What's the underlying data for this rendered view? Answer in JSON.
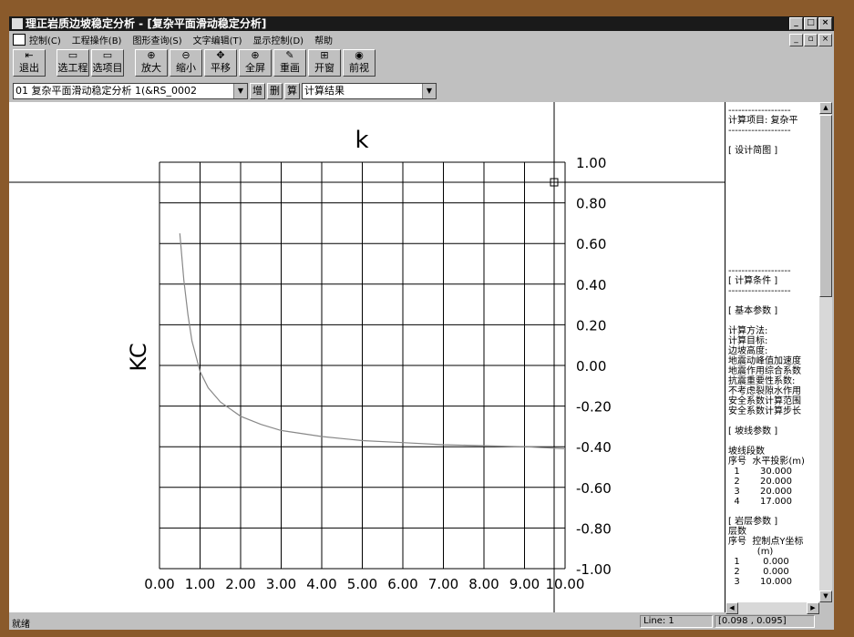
{
  "window": {
    "title": "理正岩质边坡稳定分析 - [复杂平面滑动稳定分析]",
    "buttons": [
      "_",
      "□",
      "×"
    ]
  },
  "menu": {
    "items": [
      "控制(C)",
      "工程操作(B)",
      "图形查询(S)",
      "文字编辑(T)",
      "显示控制(D)",
      "帮助"
    ],
    "mdi_buttons": [
      "_",
      "▫",
      "×"
    ]
  },
  "toolbar": {
    "buttons": [
      {
        "label": "退出",
        "icon": "exit-icon",
        "glyph": "⇤"
      },
      {
        "label": "选工程",
        "icon": "project-icon",
        "glyph": "▭"
      },
      {
        "label": "选项目",
        "icon": "item-icon",
        "glyph": "▭"
      },
      {
        "label": "放大",
        "icon": "zoom-in-icon",
        "glyph": "⊕"
      },
      {
        "label": "缩小",
        "icon": "zoom-out-icon",
        "glyph": "⊖"
      },
      {
        "label": "平移",
        "icon": "pan-icon",
        "glyph": "✥"
      },
      {
        "label": "全屏",
        "icon": "fullscreen-icon",
        "glyph": "⊕"
      },
      {
        "label": "重画",
        "icon": "redraw-icon",
        "glyph": "✎"
      },
      {
        "label": "开窗",
        "icon": "window-icon",
        "glyph": "⊞"
      },
      {
        "label": "前视",
        "icon": "front-view-icon",
        "glyph": "◉"
      }
    ]
  },
  "project_bar": {
    "selected_project": "01  复杂平面滑动稳定分析 1(&RS_0002",
    "add_label": "增",
    "delete_label": "删",
    "calc_label": "算",
    "result_view": "计算结果"
  },
  "chart_data": {
    "type": "line",
    "title": "k",
    "ylabel": "KC",
    "xlabel": "",
    "xlim": [
      0,
      10
    ],
    "ylim": [
      -1,
      1
    ],
    "x_ticks": [
      "0.00",
      "1.00",
      "2.00",
      "3.00",
      "4.00",
      "5.00",
      "6.00",
      "7.00",
      "8.00",
      "9.00",
      "10.00"
    ],
    "y_ticks": [
      "1.00",
      "0.80",
      "0.60",
      "0.40",
      "0.20",
      "0.00",
      "-0.20",
      "-0.40",
      "-0.60",
      "-0.80",
      "-1.00"
    ],
    "grid": true,
    "series": [
      {
        "x": [
          0.5,
          0.6,
          0.7,
          0.8,
          1.0,
          1.2,
          1.5,
          2.0,
          2.5,
          3.0,
          4.0,
          5.0,
          6.0,
          7.0,
          8.0,
          9.0,
          10.0
        ],
        "values": [
          0.65,
          0.42,
          0.25,
          0.12,
          -0.03,
          -0.11,
          -0.18,
          -0.25,
          -0.29,
          -0.32,
          -0.35,
          -0.37,
          -0.38,
          -0.39,
          -0.395,
          -0.4,
          -0.41
        ]
      }
    ]
  },
  "side_panel": {
    "lines": [
      "-------------------",
      "计算项目: 复杂平",
      "-------------------",
      "",
      "[ 设计简图 ]",
      "",
      "",
      "",
      "",
      "",
      "",
      "",
      "",
      "",
      "",
      "",
      "-------------------",
      "[ 计算条件 ]",
      "-------------------",
      "",
      "[ 基本参数 ]",
      "",
      "计算方法:",
      "计算目标:",
      "边坡高度:",
      "地震动峰值加速度",
      "地震作用综合系数",
      "抗震重要性系数:",
      "不考虑裂隙水作用",
      "安全系数计算范围",
      "安全系数计算步长",
      "",
      "[ 坡线参数 ]",
      "",
      "坡线段数",
      "序号  水平投影(m)",
      "  1       30.000",
      "  2       20.000",
      "  3       20.000",
      "  4       17.000",
      "",
      "[ 岩层参数 ]",
      "层数",
      "序号  控制点Y坐标",
      "          (m)",
      "  1        0.000",
      "  2        0.000",
      "  3       10.000"
    ]
  },
  "status": {
    "main": "就绪",
    "line": "Line: 1",
    "coords": "[0.098 , 0.095]"
  }
}
